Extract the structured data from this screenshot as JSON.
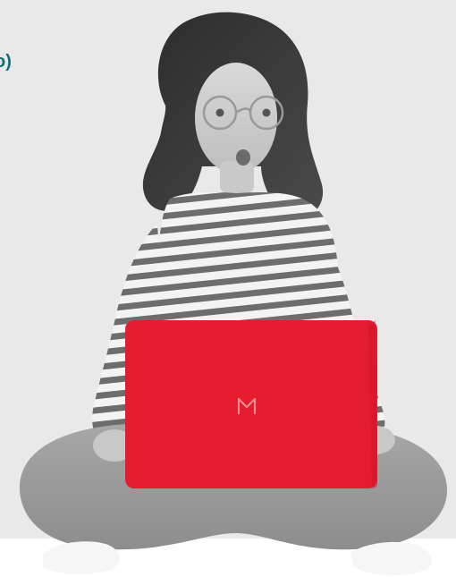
{
  "header": {
    "cut_text": "o)"
  },
  "hero": {
    "laptop_color": "#e51b2e",
    "text_color": "#0d6f78"
  }
}
